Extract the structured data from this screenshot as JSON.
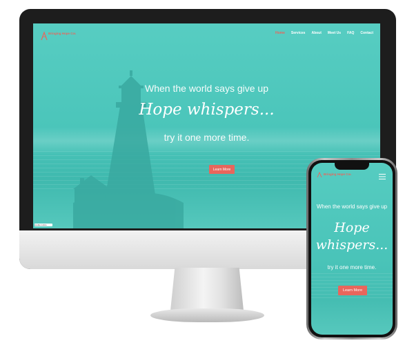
{
  "site": {
    "logo_text": "Bringing Hope Counseling",
    "colors": {
      "accent": "#e8665c",
      "teal": "#4ac4b9",
      "text": "#ffffff"
    }
  },
  "desktop": {
    "nav": [
      {
        "label": "Home",
        "active": true
      },
      {
        "label": "Services"
      },
      {
        "label": "About"
      },
      {
        "label": "Meet Us"
      },
      {
        "label": "FAQ"
      },
      {
        "label": "Contact"
      }
    ],
    "hero": {
      "line1": "When the world says give up",
      "line2": "Hope whispers...",
      "line3": "try it one more time.",
      "button": "Learn More"
    },
    "cookie_notice": "cookie notice"
  },
  "mobile": {
    "logo_text": "Bringing Hope Counseling",
    "hero": {
      "line1": "When the world says give up",
      "line2a": "Hope",
      "line2b": "whispers...",
      "line3": "try it one more time.",
      "button": "Learn More"
    },
    "icons": {
      "menu": "hamburger-icon"
    }
  }
}
